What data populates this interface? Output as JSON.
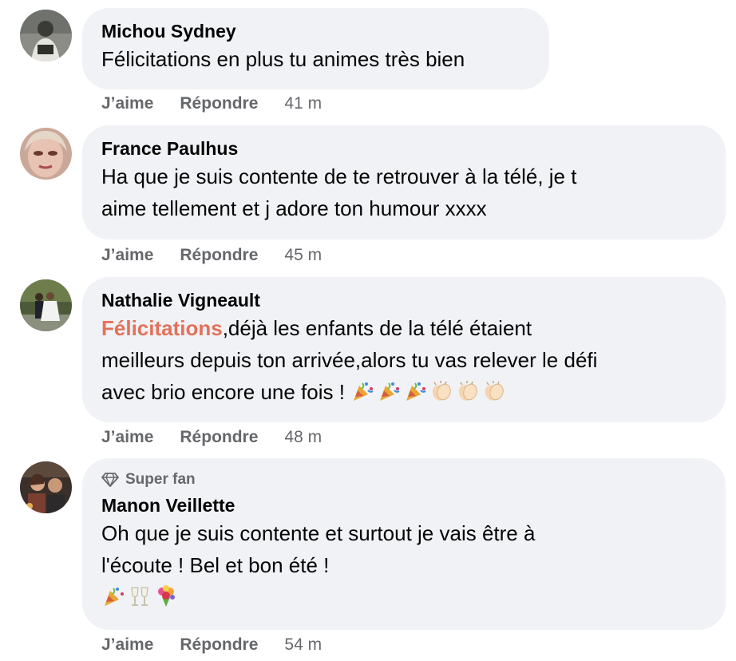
{
  "actions": {
    "like_label": "J’aime",
    "reply_label": "Répondre"
  },
  "comments": [
    {
      "author": "Michou Sydney",
      "text": "Félicitations en plus tu animes très bien",
      "time": "41 m"
    },
    {
      "author": "France Paulhus",
      "text_line1": "Ha que je suis contente de te retrouver à la télé, je t",
      "text_line2": "aime tellement et j adore ton humour xxxx",
      "time": "45 m"
    },
    {
      "author": "Nathalie Vigneault",
      "mention": "Félicitations",
      "text_part1": ",déjà les enfants de la télé étaient",
      "text_line2": "meilleurs depuis ton arrivée,alors tu vas relever le défi",
      "text_line3": "avec brio encore une fois !",
      "emojis": [
        "party-popper",
        "party-popper",
        "party-popper",
        "clapping-hands",
        "clapping-hands",
        "clapping-hands"
      ],
      "time": "48 m"
    },
    {
      "badge": "Super fan",
      "badge_icon": "diamond-icon",
      "author": "Manon Veillette",
      "text_line1": "Oh que je suis contente et surtout je vais être à",
      "text_line2": "l'écoute ! Bel et bon été !",
      "emojis": [
        "party-popper",
        "champagne-glasses",
        "bouquet"
      ],
      "time": "54 m"
    }
  ],
  "colors": {
    "bubble": "#f0f2f5",
    "meta": "#65676b",
    "mention": "#e4715a"
  }
}
